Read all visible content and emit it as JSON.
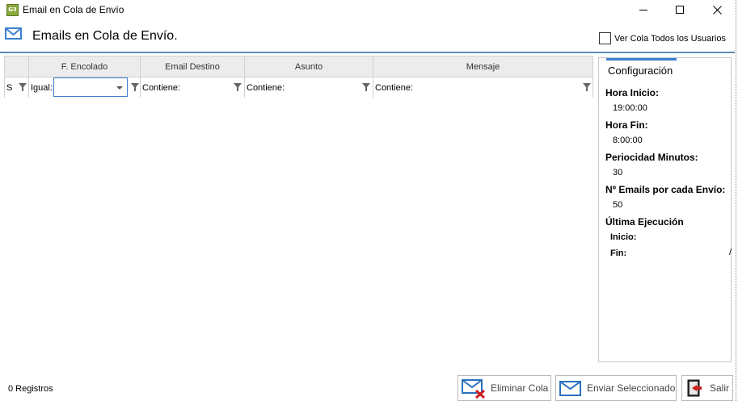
{
  "window": {
    "icon_text": "G3",
    "title": "Email en Cola de Envío"
  },
  "header": {
    "title": "Emails en Cola de Envío.",
    "checkbox_label": "Ver Cola Todos los Usuarios",
    "checkbox_checked": false
  },
  "grid": {
    "columns": [
      "F. Encolado",
      "Email Destino",
      "Asunto",
      "Mensaje"
    ],
    "filters": {
      "status": "S",
      "fecha": "Igual:",
      "fecha_value": "",
      "email": "Contiene:",
      "asunto": "Contiene:",
      "mensaje": "Contiene:"
    },
    "rows": []
  },
  "config": {
    "tab": "Configuración",
    "hora_inicio_label": "Hora Inicio:",
    "hora_inicio": "19:00:00",
    "hora_fin_label": "Hora Fin:",
    "hora_fin": "8:00:00",
    "periodicidad_label": "Periocidad Minutos:",
    "periodicidad": "30",
    "emails_label": "Nº Emails por cada Envío:",
    "emails": "50",
    "ultima_label": "Última Ejecución",
    "inicio_label": "Inicio:",
    "fin_label": "Fin:",
    "slash": "/"
  },
  "footer": {
    "count": "0 Registros",
    "eliminar": "Eliminar Cola",
    "enviar": "Enviar Seleccionado",
    "salir": "Salir"
  },
  "colors": {
    "accent": "#3c7fd0",
    "header_line": "#5b8db8",
    "grid_header_bg": "#ececec"
  }
}
